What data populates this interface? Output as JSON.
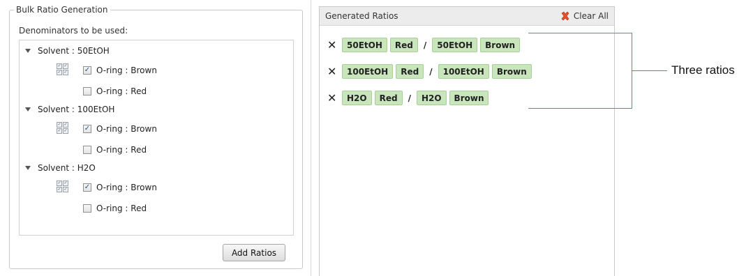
{
  "bulk": {
    "title": "Bulk Ratio Generation",
    "denominators_label": "Denominators to be used:",
    "solvents": [
      {
        "label": "Solvent : 50EtOH",
        "options": [
          {
            "label": "O-ring : Brown",
            "checked": true
          },
          {
            "label": "O-ring : Red",
            "checked": false
          }
        ]
      },
      {
        "label": "Solvent : 100EtOH",
        "options": [
          {
            "label": "O-ring : Brown",
            "checked": true
          },
          {
            "label": "O-ring : Red",
            "checked": false
          }
        ]
      },
      {
        "label": "Solvent : H2O",
        "options": [
          {
            "label": "O-ring : Brown",
            "checked": true
          },
          {
            "label": "O-ring : Red",
            "checked": false
          }
        ]
      }
    ],
    "add_button": "Add Ratios"
  },
  "generated": {
    "title": "Generated Ratios",
    "clear_all": "Clear All",
    "clear_icon": "red-x-icon",
    "ratios": [
      {
        "num_solvent": "50EtOH",
        "num_oring": "Red",
        "slash": "/",
        "den_solvent": "50EtOH",
        "den_oring": "Brown"
      },
      {
        "num_solvent": "100EtOH",
        "num_oring": "Red",
        "slash": "/",
        "den_solvent": "100EtOH",
        "den_oring": "Brown"
      },
      {
        "num_solvent": "H2O",
        "num_oring": "Red",
        "slash": "/",
        "den_solvent": "H2O",
        "den_oring": "Brown"
      }
    ],
    "remove_glyph": "✕"
  },
  "callout": {
    "label": "Three ratios"
  },
  "colors": {
    "tag_fill": "#c8e5bb",
    "tag_border": "#a9cf98",
    "callout_line": "#5a86b8",
    "clear_icon": "#e0512b"
  }
}
